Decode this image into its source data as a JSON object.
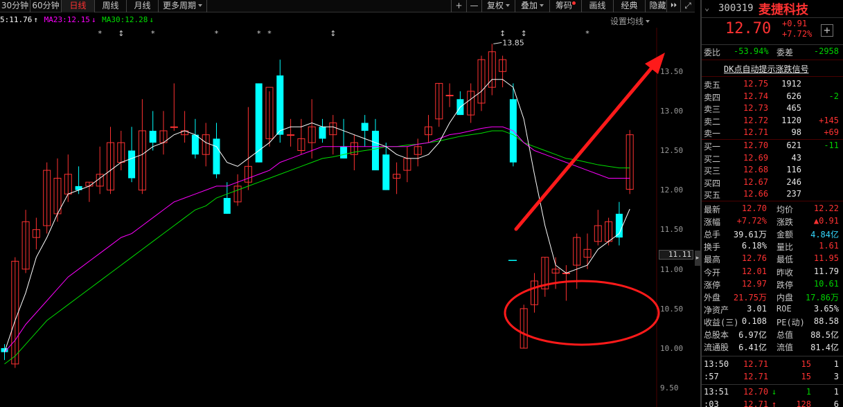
{
  "toolbar": {
    "tabs": [
      "30分钟",
      "60分钟",
      "日线",
      "周线",
      "月线",
      "更多周期"
    ],
    "active_tab": "日线",
    "tools": [
      "+",
      "—",
      "复权",
      "叠加",
      "筹码",
      "画线",
      "经典",
      "隐藏",
      "⏵⏵",
      "⤢"
    ]
  },
  "legend": {
    "ma5": "5:11.76",
    "ma23": "MA23:12.15",
    "ma30": "MA30:12.28",
    "ma_settings": "设置均线"
  },
  "colors": {
    "up": "#ff3232",
    "down": "#00ffff",
    "ma5": "#ffffff",
    "ma23": "#ff00ff",
    "ma30": "#00e000",
    "annotation": "#ff1a1a"
  },
  "chart_data": {
    "type": "candlestick",
    "y_axis": {
      "labels": [
        "13.50",
        "13.00",
        "12.50",
        "12.00",
        "11.50",
        "11.00",
        "10.50",
        "10.00",
        "9.50"
      ],
      "ylim": [
        9.4,
        13.9
      ]
    },
    "high_label": "13.85",
    "price_readout": "11.11",
    "markers": [
      "*",
      "↕",
      "*",
      "*",
      "*",
      "*",
      "↕",
      "↕",
      "↕",
      "*"
    ],
    "candles": [
      {
        "o": 10.0,
        "h": 10.05,
        "l": 9.85,
        "c": 9.95
      },
      {
        "o": 9.8,
        "h": 11.15,
        "l": 9.75,
        "c": 11.1
      },
      {
        "o": 11.0,
        "h": 11.75,
        "l": 10.95,
        "c": 11.6
      },
      {
        "o": 11.4,
        "h": 11.65,
        "l": 11.25,
        "c": 11.5
      },
      {
        "o": 11.55,
        "h": 12.35,
        "l": 11.45,
        "c": 12.25
      },
      {
        "o": 11.7,
        "h": 12.4,
        "l": 11.6,
        "c": 12.15
      },
      {
        "o": 11.95,
        "h": 12.45,
        "l": 11.85,
        "c": 12.2
      },
      {
        "o": 12.05,
        "h": 12.3,
        "l": 11.95,
        "c": 12.0
      },
      {
        "o": 12.05,
        "h": 12.1,
        "l": 11.85,
        "c": 12.1
      },
      {
        "o": 12.05,
        "h": 12.55,
        "l": 11.95,
        "c": 12.2
      },
      {
        "o": 12.0,
        "h": 12.8,
        "l": 11.95,
        "c": 12.6
      },
      {
        "o": 12.35,
        "h": 12.75,
        "l": 12.25,
        "c": 12.6
      },
      {
        "o": 12.5,
        "h": 12.8,
        "l": 12.1,
        "c": 12.15
      },
      {
        "o": 12.0,
        "h": 13.15,
        "l": 11.95,
        "c": 12.75
      },
      {
        "o": 12.75,
        "h": 13.0,
        "l": 12.5,
        "c": 12.6
      },
      {
        "o": 12.6,
        "h": 13.0,
        "l": 12.45,
        "c": 12.75
      },
      {
        "o": 12.8,
        "h": 13.35,
        "l": 12.75,
        "c": 12.8
      },
      {
        "o": 12.7,
        "h": 13.0,
        "l": 12.6,
        "c": 12.75
      },
      {
        "o": 12.7,
        "h": 12.9,
        "l": 12.4,
        "c": 12.45
      },
      {
        "o": 12.45,
        "h": 12.85,
        "l": 12.3,
        "c": 12.7
      },
      {
        "o": 12.65,
        "h": 12.85,
        "l": 12.15,
        "c": 12.2
      },
      {
        "o": 11.9,
        "h": 12.1,
        "l": 11.7,
        "c": 11.7
      },
      {
        "o": 11.85,
        "h": 12.2,
        "l": 11.8,
        "c": 12.05
      },
      {
        "o": 12.1,
        "h": 13.05,
        "l": 12.0,
        "c": 12.3
      },
      {
        "o": 13.35,
        "h": 13.35,
        "l": 12.35,
        "c": 12.35
      },
      {
        "o": 12.65,
        "h": 13.25,
        "l": 12.55,
        "c": 13.3
      },
      {
        "o": 13.45,
        "h": 13.65,
        "l": 12.6,
        "c": 12.7
      },
      {
        "o": 12.7,
        "h": 12.9,
        "l": 12.55,
        "c": 12.7
      },
      {
        "o": 12.5,
        "h": 12.9,
        "l": 12.45,
        "c": 12.65
      },
      {
        "o": 12.6,
        "h": 13.15,
        "l": 12.4,
        "c": 12.8
      },
      {
        "o": 12.8,
        "h": 12.9,
        "l": 12.6,
        "c": 12.65
      },
      {
        "o": 12.7,
        "h": 12.95,
        "l": 12.45,
        "c": 12.85
      },
      {
        "o": 12.55,
        "h": 12.9,
        "l": 12.4,
        "c": 12.4
      },
      {
        "o": 12.45,
        "h": 12.7,
        "l": 12.25,
        "c": 12.6
      },
      {
        "o": 12.85,
        "h": 12.95,
        "l": 12.55,
        "c": 12.75
      },
      {
        "o": 12.75,
        "h": 12.9,
        "l": 12.3,
        "c": 12.25
      },
      {
        "o": 12.45,
        "h": 12.6,
        "l": 12.0,
        "c": 12.0
      },
      {
        "o": 12.15,
        "h": 12.35,
        "l": 11.95,
        "c": 12.2
      },
      {
        "o": 12.25,
        "h": 12.55,
        "l": 12.1,
        "c": 12.4
      },
      {
        "o": 12.45,
        "h": 12.65,
        "l": 12.3,
        "c": 12.55
      },
      {
        "o": 12.7,
        "h": 12.95,
        "l": 12.6,
        "c": 12.8
      },
      {
        "o": 12.9,
        "h": 13.35,
        "l": 12.8,
        "c": 13.35
      },
      {
        "o": 13.2,
        "h": 13.35,
        "l": 13.05,
        "c": 13.2
      },
      {
        "o": 13.15,
        "h": 13.25,
        "l": 12.95,
        "c": 12.95
      },
      {
        "o": 12.95,
        "h": 13.35,
        "l": 12.85,
        "c": 13.25
      },
      {
        "o": 13.1,
        "h": 13.7,
        "l": 13.0,
        "c": 13.65
      },
      {
        "o": 13.3,
        "h": 13.85,
        "l": 13.2,
        "c": 13.75
      },
      {
        "o": 13.5,
        "h": 13.7,
        "l": 13.3,
        "c": 13.65
      },
      {
        "o": 13.15,
        "h": 13.35,
        "l": 12.3,
        "c": 12.35
      },
      {
        "o": 10.0,
        "h": 10.55,
        "l": 10.0,
        "c": 10.5
      },
      {
        "o": 10.55,
        "h": 10.95,
        "l": 10.45,
        "c": 10.85
      },
      {
        "o": 10.75,
        "h": 11.15,
        "l": 10.65,
        "c": 11.15
      },
      {
        "o": 10.95,
        "h": 11.15,
        "l": 10.75,
        "c": 11.0
      },
      {
        "o": 10.95,
        "h": 11.05,
        "l": 10.6,
        "c": 10.95
      },
      {
        "o": 11.05,
        "h": 11.45,
        "l": 10.75,
        "c": 11.4
      },
      {
        "o": 11.15,
        "h": 11.45,
        "l": 11.0,
        "c": 11.25
      },
      {
        "o": 11.35,
        "h": 11.75,
        "l": 11.3,
        "c": 11.55
      },
      {
        "o": 11.35,
        "h": 11.65,
        "l": 11.3,
        "c": 11.6
      },
      {
        "o": 11.7,
        "h": 11.85,
        "l": 11.3,
        "c": 11.4
      },
      {
        "o": 12.01,
        "h": 12.76,
        "l": 11.95,
        "c": 12.7
      }
    ],
    "ma5": [
      9.95,
      10.35,
      10.7,
      11.15,
      11.4,
      11.7,
      11.95,
      12.0,
      12.05,
      12.15,
      12.25,
      12.35,
      12.4,
      12.45,
      12.55,
      12.6,
      12.7,
      12.75,
      12.7,
      12.6,
      12.55,
      12.35,
      12.3,
      12.4,
      12.5,
      12.6,
      12.75,
      12.8,
      12.8,
      12.85,
      12.8,
      12.8,
      12.75,
      12.7,
      12.65,
      12.6,
      12.55,
      12.45,
      12.4,
      12.4,
      12.45,
      12.6,
      12.85,
      13.05,
      13.15,
      13.25,
      13.4,
      13.4,
      13.3,
      12.9,
      12.2,
      11.55,
      11.05,
      10.95,
      11.0,
      11.05,
      11.25,
      11.35,
      11.45,
      11.76
    ],
    "ma23": [
      9.95,
      10.1,
      10.3,
      10.45,
      10.6,
      10.75,
      10.9,
      11.0,
      11.1,
      11.2,
      11.3,
      11.4,
      11.45,
      11.55,
      11.65,
      11.75,
      11.85,
      11.9,
      11.95,
      12.0,
      12.05,
      12.05,
      12.1,
      12.15,
      12.2,
      12.25,
      12.35,
      12.4,
      12.45,
      12.5,
      12.55,
      12.55,
      12.55,
      12.55,
      12.55,
      12.55,
      12.55,
      12.55,
      12.55,
      12.58,
      12.6,
      12.65,
      12.7,
      12.72,
      12.75,
      12.78,
      12.8,
      12.8,
      12.75,
      12.6,
      12.5,
      12.45,
      12.4,
      12.35,
      12.3,
      12.25,
      12.2,
      12.15,
      12.15,
      12.15
    ],
    "ma30": [
      9.8,
      9.9,
      10.05,
      10.2,
      10.35,
      10.45,
      10.55,
      10.65,
      10.75,
      10.85,
      10.95,
      11.05,
      11.15,
      11.25,
      11.35,
      11.45,
      11.55,
      11.65,
      11.75,
      11.8,
      11.9,
      11.95,
      12.0,
      12.05,
      12.1,
      12.15,
      12.2,
      12.25,
      12.3,
      12.35,
      12.4,
      12.42,
      12.45,
      12.48,
      12.5,
      12.52,
      12.55,
      12.55,
      12.57,
      12.58,
      12.6,
      12.62,
      12.65,
      12.68,
      12.7,
      12.72,
      12.75,
      12.75,
      12.7,
      12.6,
      12.55,
      12.5,
      12.45,
      12.4,
      12.38,
      12.35,
      12.32,
      12.3,
      12.28,
      12.28
    ]
  },
  "quote": {
    "code": "300319",
    "name": "麦捷科技",
    "price": "12.70",
    "change": "+0.91",
    "change_pct": "+7.72%",
    "weibi_label": "委比",
    "weibi": "-53.94%",
    "weicha_label": "委差",
    "weicha": "-2958",
    "signal_banner": "DK点自动提示涨跌信号",
    "asks": [
      {
        "label": "卖五",
        "price": "12.75",
        "vol": "1912",
        "delta": ""
      },
      {
        "label": "卖四",
        "price": "12.74",
        "vol": "626",
        "delta": "-2"
      },
      {
        "label": "卖三",
        "price": "12.73",
        "vol": "465",
        "delta": ""
      },
      {
        "label": "卖二",
        "price": "12.72",
        "vol": "1120",
        "delta": "+145"
      },
      {
        "label": "卖一",
        "price": "12.71",
        "vol": "98",
        "delta": "+69"
      }
    ],
    "bids": [
      {
        "label": "买一",
        "price": "12.70",
        "vol": "621",
        "delta": "-11"
      },
      {
        "label": "买二",
        "price": "12.69",
        "vol": "43",
        "delta": ""
      },
      {
        "label": "买三",
        "price": "12.68",
        "vol": "116",
        "delta": ""
      },
      {
        "label": "买四",
        "price": "12.67",
        "vol": "246",
        "delta": ""
      },
      {
        "label": "买五",
        "price": "12.66",
        "vol": "237",
        "delta": ""
      }
    ],
    "stats": [
      {
        "l1": "最新",
        "v1": "12.70",
        "c1": "red",
        "l2": "均价",
        "v2": "12.22",
        "c2": "red"
      },
      {
        "l1": "涨幅",
        "v1": "+7.72%",
        "c1": "red",
        "l2": "涨跌",
        "v2": "▲0.91",
        "c2": "red"
      },
      {
        "l1": "总手",
        "v1": "39.61万",
        "c1": "white",
        "l2": "金额",
        "v2": "4.84亿",
        "c2": "cyan"
      },
      {
        "l1": "换手",
        "v1": "6.18%",
        "c1": "white",
        "l2": "量比",
        "v2": "1.61",
        "c2": "red"
      },
      {
        "l1": "最高",
        "v1": "12.76",
        "c1": "red",
        "l2": "最低",
        "v2": "11.95",
        "c2": "red"
      },
      {
        "l1": "今开",
        "v1": "12.01",
        "c1": "red",
        "l2": "昨收",
        "v2": "11.79",
        "c2": "white"
      },
      {
        "l1": "涨停",
        "v1": "12.97",
        "c1": "red",
        "l2": "跌停",
        "v2": "10.61",
        "c2": "green"
      },
      {
        "l1": "外盘",
        "v1": "21.75万",
        "c1": "red",
        "l2": "内盘",
        "v2": "17.86万",
        "c2": "green"
      },
      {
        "l1": "净资产",
        "v1": "3.01",
        "c1": "white",
        "l2": "ROE",
        "v2": "3.65%",
        "c2": "white"
      },
      {
        "l1": "收益(三)",
        "v1": "0.108",
        "c1": "white",
        "l2": "PE(动)",
        "v2": "88.58",
        "c2": "white"
      },
      {
        "l1": "总股本",
        "v1": "6.97亿",
        "c1": "white",
        "l2": "总值",
        "v2": "88.5亿",
        "c2": "white"
      },
      {
        "l1": "流通股",
        "v1": "6.41亿",
        "c1": "white",
        "l2": "流值",
        "v2": "81.4亿",
        "c2": "white"
      }
    ],
    "ticks": [
      {
        "time": "13:50",
        "price": "12.71",
        "arrow": "",
        "vol": "15",
        "n": "1"
      },
      {
        "time": ":57",
        "price": "12.71",
        "arrow": "",
        "vol": "15",
        "n": "3"
      },
      {
        "time": "13:51",
        "price": "12.70",
        "arrow": "↓",
        "vol": "1",
        "n": "1"
      },
      {
        "time": ":03",
        "price": "12.71",
        "arrow": "↑",
        "vol": "128",
        "n": "6"
      }
    ]
  }
}
